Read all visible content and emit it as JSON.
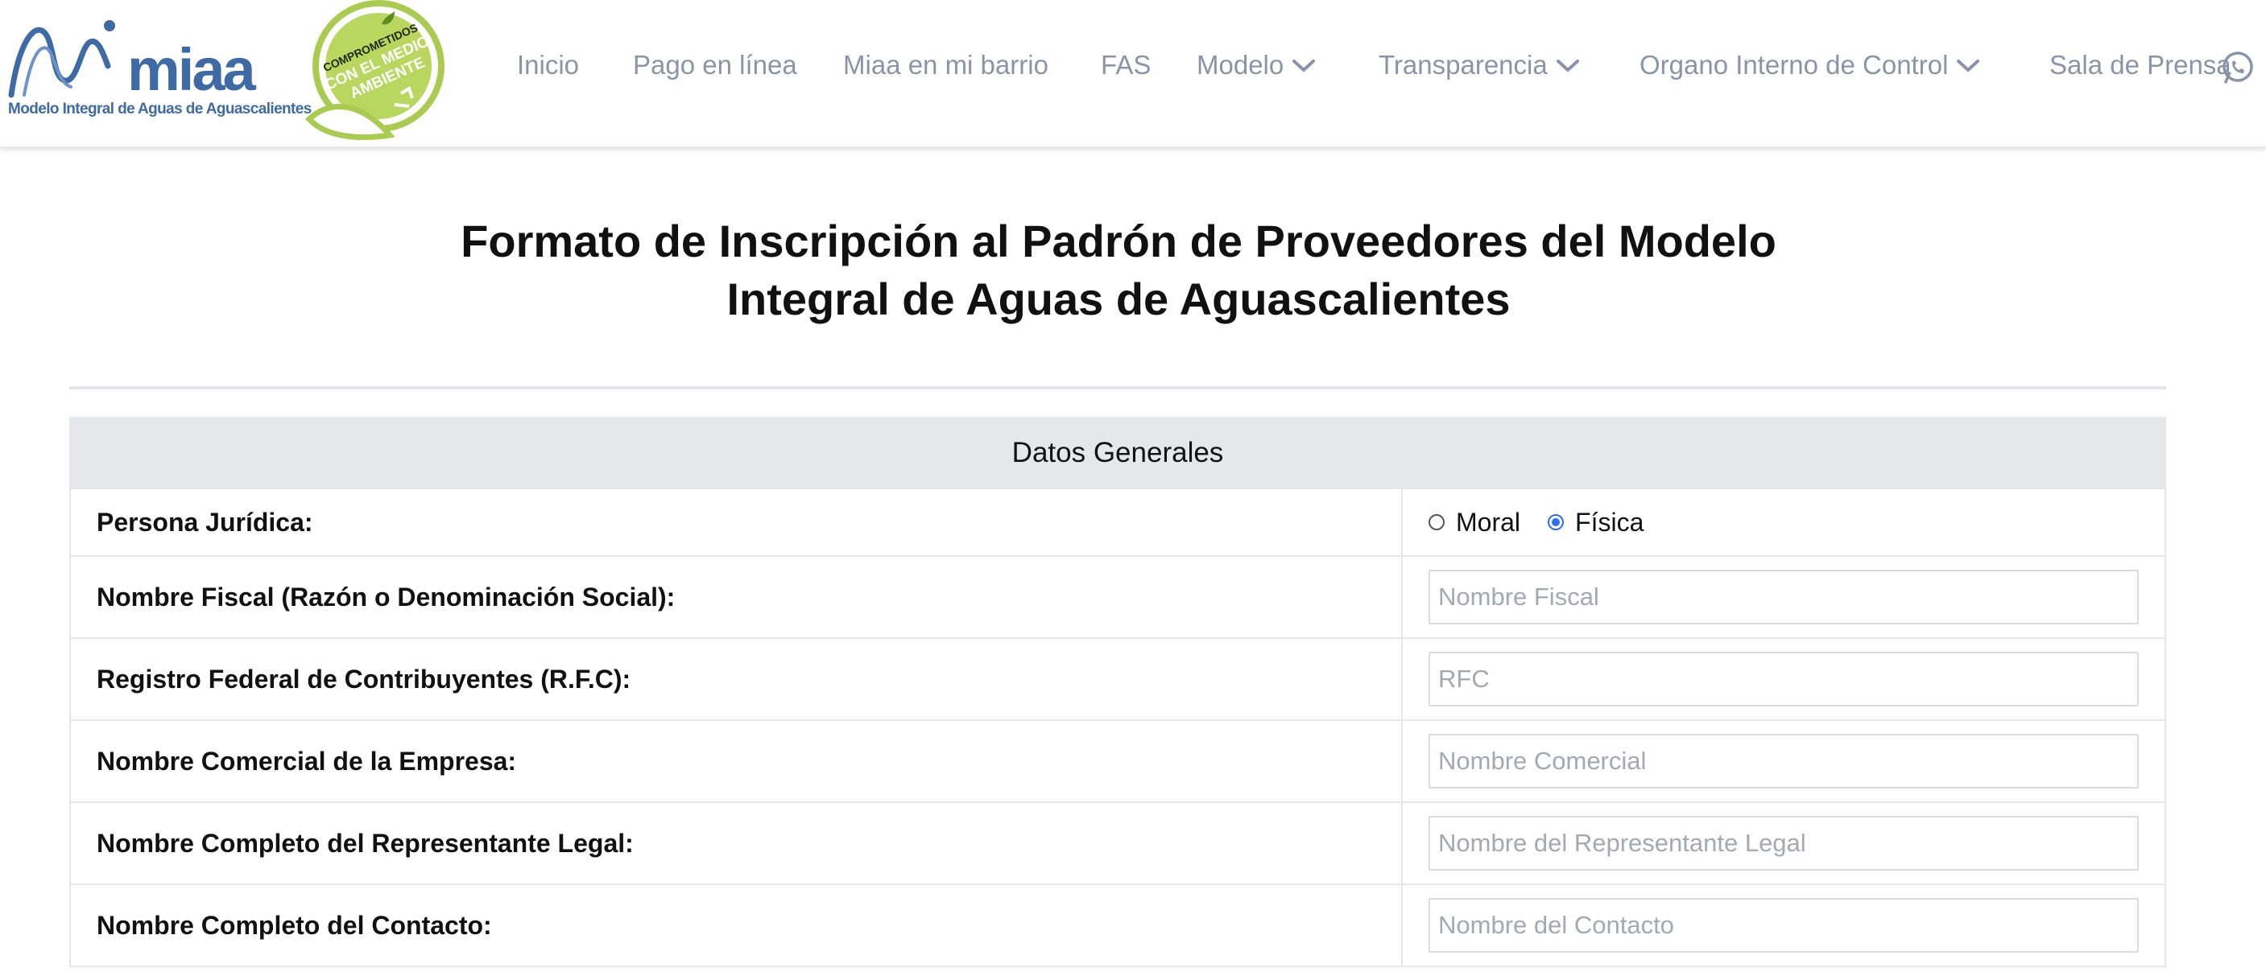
{
  "brand": {
    "name": "miaa",
    "caption": "Modelo Integral de Aguas de Aguascalientes",
    "badge_lines": [
      "COMPROMETIDOS",
      "CON EL MEDIO",
      "AMBIENTE"
    ],
    "primary_color": "#3e6aa6",
    "badge_color": "#a9cc50"
  },
  "nav": {
    "items": [
      {
        "label": "Inicio",
        "dropdown": false
      },
      {
        "label": "Pago en línea",
        "dropdown": false
      },
      {
        "label": "Miaa en mi barrio",
        "dropdown": false
      },
      {
        "label": "FAS",
        "dropdown": false
      },
      {
        "label": "Modelo",
        "dropdown": true
      },
      {
        "label": "Transparencia",
        "dropdown": true
      },
      {
        "label": "Organo Interno de Control",
        "dropdown": true
      },
      {
        "label": "Sala de Prensa",
        "dropdown": false
      }
    ],
    "whatsapp_icon": "whatsapp-icon",
    "text_color": "#8a94a8"
  },
  "page": {
    "title_line1": "Formato de Inscripción al Padrón de Proveedores del Modelo",
    "title_line2": "Integral de Aguas de Aguascalientes"
  },
  "form": {
    "section_title": "Datos Generales",
    "persona": {
      "label": "Persona Jurídica:",
      "options": [
        {
          "label": "Moral",
          "checked": false
        },
        {
          "label": "Física",
          "checked": true
        }
      ]
    },
    "fields": [
      {
        "label": "Nombre Fiscal (Razón o Denominación Social):",
        "placeholder": "Nombre Fiscal",
        "value": ""
      },
      {
        "label": "Registro Federal de Contribuyentes (R.F.C):",
        "placeholder": "RFC",
        "value": ""
      },
      {
        "label": "Nombre Comercial de la Empresa:",
        "placeholder": "Nombre Comercial",
        "value": ""
      },
      {
        "label": "Nombre Completo del Representante Legal:",
        "placeholder": "Nombre del Representante Legal",
        "value": ""
      },
      {
        "label": "Nombre Completo del Contacto:",
        "placeholder": "Nombre del Contacto",
        "value": ""
      }
    ],
    "accent_color": "#2b6ef0"
  }
}
